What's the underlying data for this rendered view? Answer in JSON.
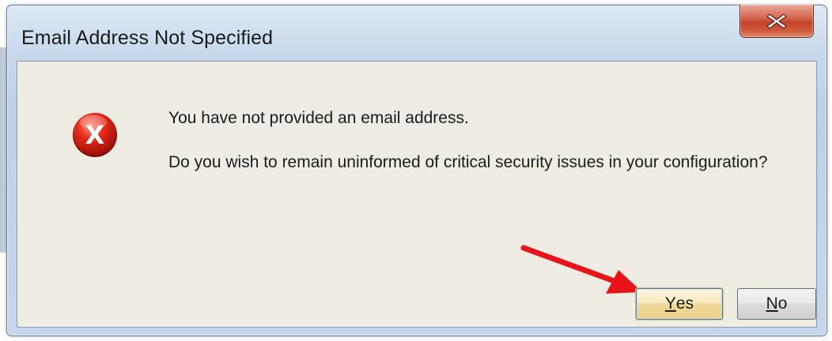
{
  "window": {
    "title": "Email Address Not Specified",
    "close_icon": "close-icon"
  },
  "dialog": {
    "icon": "error-icon",
    "icon_glyph": "X",
    "message_line1": "You have not provided an email address.",
    "message_line2": "Do you wish to remain uninformed of critical security issues in your configuration?"
  },
  "buttons": {
    "yes": {
      "mnemonic": "Y",
      "rest": "es"
    },
    "no": {
      "mnemonic": "N",
      "rest": "o"
    }
  },
  "annotation": {
    "arrow_icon": "red-arrow-icon",
    "arrow_color": "#e8141a"
  },
  "colors": {
    "client_bg": "#eeece3",
    "close_button": "#c4442a",
    "title_frame": "#c9d9ec"
  }
}
